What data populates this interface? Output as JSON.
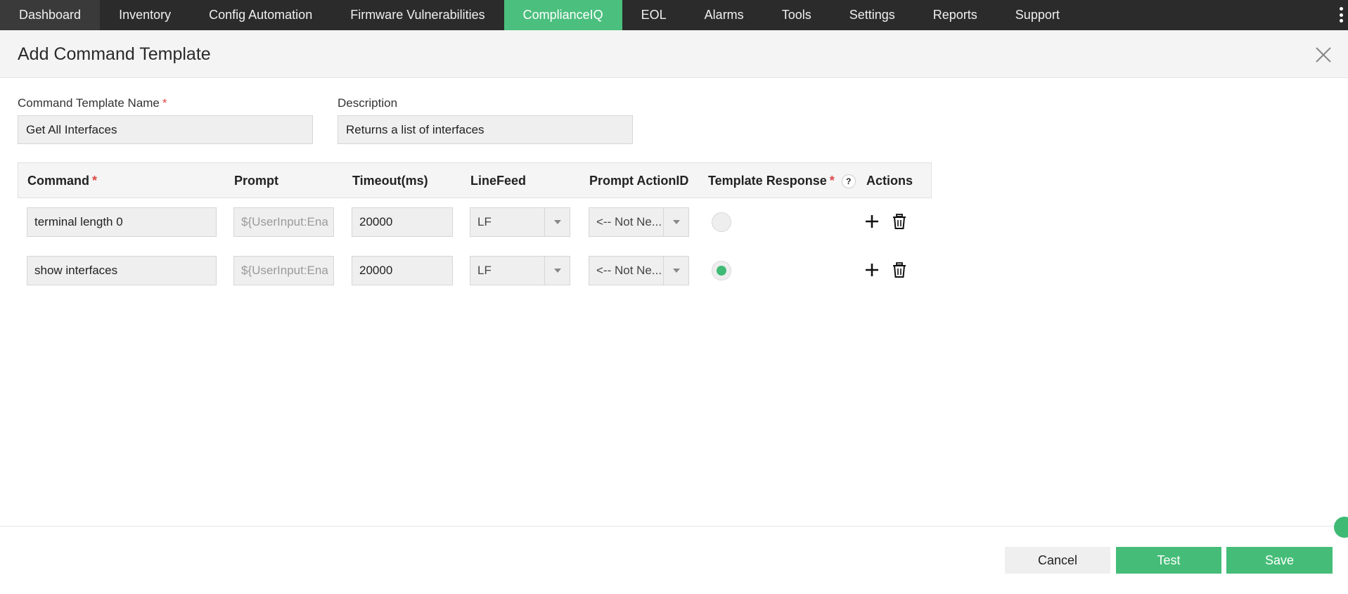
{
  "nav": {
    "tabs": [
      {
        "label": "Dashboard"
      },
      {
        "label": "Inventory"
      },
      {
        "label": "Config Automation"
      },
      {
        "label": "Firmware Vulnerabilities"
      },
      {
        "label": "ComplianceIQ"
      },
      {
        "label": "EOL"
      },
      {
        "label": "Alarms"
      },
      {
        "label": "Tools"
      },
      {
        "label": "Settings"
      },
      {
        "label": "Reports"
      },
      {
        "label": "Support"
      }
    ],
    "active_tab": "ComplianceIQ"
  },
  "header": {
    "title": "Add Command Template"
  },
  "form": {
    "name_label": "Command Template Name",
    "name_value": "Get All Interfaces",
    "description_label": "Description",
    "description_value": "Returns a list of interfaces",
    "required_mark": "*"
  },
  "table": {
    "headers": {
      "command": "Command",
      "prompt": "Prompt",
      "timeout": "Timeout(ms)",
      "linefeed": "LineFeed",
      "prompt_action": "Prompt ActionID",
      "template_response": "Template Response",
      "actions": "Actions",
      "help": "?"
    },
    "rows": [
      {
        "command": "terminal length 0",
        "prompt": "${UserInput:Ena",
        "timeout": "20000",
        "linefeed": "LF",
        "prompt_action": "<-- Not Ne...",
        "template_response_selected": false
      },
      {
        "command": "show interfaces",
        "prompt": "${UserInput:Ena",
        "timeout": "20000",
        "linefeed": "LF",
        "prompt_action": "<-- Not Ne...",
        "template_response_selected": true
      }
    ]
  },
  "footer": {
    "cancel": "Cancel",
    "test": "Test",
    "save": "Save"
  },
  "colors": {
    "accent": "#4bbf7e",
    "nav_bg": "#2b2b2b",
    "required": "#e04848"
  }
}
